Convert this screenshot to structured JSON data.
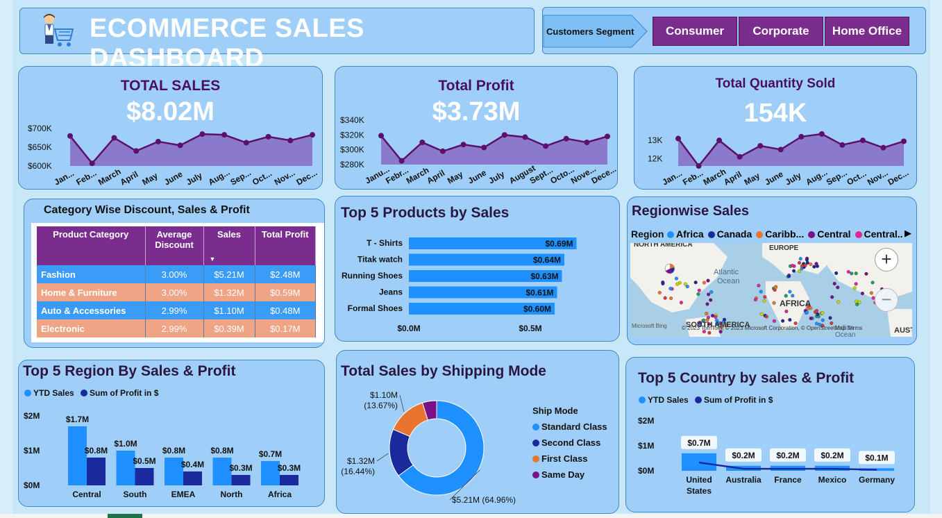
{
  "header": {
    "title": "ECOMMERCE SALES DASHBOARD",
    "segment_label": "Customers Segment",
    "segments": [
      "Consumer",
      "Corporate",
      "Home Office"
    ]
  },
  "colors": {
    "purple": "#7b2d8e",
    "dark_purple": "#4a0f5c",
    "line": "#5c0f6b",
    "area": "#8a74c9",
    "blue": "#1e90ff",
    "navy": "#1a2a9c",
    "orange": "#e8742f",
    "magenta": "#7a0f8a",
    "card": "#9fcff8",
    "row_blue": "#3a9cf7",
    "row_peach": "#efa486"
  },
  "kpis": {
    "sales": {
      "title": "TOTAL SALES",
      "value": "$8.02M"
    },
    "profit": {
      "title": "Total Profit",
      "value": "$3.73M"
    },
    "quantity": {
      "title": "Total Quantity Sold",
      "value": "154K"
    }
  },
  "category_table": {
    "title": "Category Wise Discount, Sales & Profit",
    "headers": [
      "Product Category",
      "Average Discount",
      "Sales",
      "Total Profit"
    ],
    "rows": [
      [
        "Fashion",
        "3.00%",
        "$5.21M",
        "$2.48M"
      ],
      [
        "Home & Furniture",
        "3.00%",
        "$1.32M",
        "$0.59M"
      ],
      [
        "Auto & Accessories",
        "2.99%",
        "$1.10M",
        "$0.48M"
      ],
      [
        "Electronic",
        "2.99%",
        "$0.39M",
        "$0.17M"
      ]
    ]
  },
  "map": {
    "title": "Regionwise Sales",
    "legend_title": "Region",
    "legend": [
      {
        "name": "Africa",
        "color": "#1e90ff"
      },
      {
        "name": "Canada",
        "color": "#1a2a9c"
      },
      {
        "name": "Caribb...",
        "color": "#e8742f"
      },
      {
        "name": "Central",
        "color": "#7a0f8a"
      },
      {
        "name": "Central...",
        "color": "#e0259b"
      }
    ],
    "labels": [
      "NORTH AMERICA",
      "EUROPE",
      "Atlantic",
      "Ocean",
      "AFRICA",
      "SOUTH AMERICA",
      "Indian",
      "Ocean",
      "AUST"
    ],
    "attribution": "Microsoft Bing",
    "copyright": "© 2023 TomTom, © 2023 Microsoft Corporation, © OpenStreetMap  Terms"
  },
  "chart_data": [
    {
      "id": "monthly_sales",
      "type": "area",
      "categories": [
        "Jan...",
        "Feb...",
        "March",
        "April",
        "May",
        "June",
        "July",
        "Aug...",
        "Sep...",
        "Oct...",
        "Nov...",
        "Dec..."
      ],
      "values": [
        680,
        607,
        675,
        640,
        665,
        655,
        685,
        683,
        662,
        678,
        668,
        683
      ],
      "y_ticks": [
        "$700K",
        "$650K",
        "$600K"
      ],
      "y_tick_values": [
        700,
        650,
        600
      ],
      "ylim": [
        600,
        700
      ],
      "unit": "K$"
    },
    {
      "id": "monthly_profit",
      "type": "area",
      "categories": [
        "Janu...",
        "Febr...",
        "March",
        "April",
        "May",
        "June",
        "July",
        "August",
        "Sept...",
        "Octo...",
        "Nove...",
        "Dece..."
      ],
      "values": [
        319,
        285,
        310,
        298,
        307,
        303,
        320,
        317,
        305,
        315,
        310,
        318
      ],
      "y_ticks": [
        "$340K",
        "$320K",
        "$300K",
        "$280K"
      ],
      "y_tick_values": [
        340,
        320,
        300,
        280
      ],
      "ylim": [
        280,
        340
      ],
      "unit": "K$"
    },
    {
      "id": "monthly_quantity",
      "type": "area",
      "categories": [
        "Jan...",
        "Feb...",
        "March",
        "April",
        "May",
        "June",
        "July",
        "Aug...",
        "Sep...",
        "Oct...",
        "Nov...",
        "Dec..."
      ],
      "values": [
        13.1,
        11.6,
        13.0,
        12.1,
        12.7,
        12.5,
        13.2,
        13.35,
        12.75,
        13.0,
        12.6,
        12.95
      ],
      "y_ticks": [
        "13K",
        "12K"
      ],
      "y_tick_values": [
        13,
        12
      ],
      "ylim": [
        11.6,
        13.5
      ],
      "unit": "K"
    },
    {
      "id": "top_products",
      "type": "bar",
      "title": "Top 5 Products by Sales",
      "categories": [
        "T - Shirts",
        "Titak watch",
        "Running Shoes",
        "Jeans",
        "Formal Shoes"
      ],
      "values": [
        0.69,
        0.64,
        0.63,
        0.61,
        0.6
      ],
      "labels": [
        "$0.69M",
        "$0.64M",
        "$0.63M",
        "$0.61M",
        "$0.60M"
      ],
      "x_ticks": [
        "$0.0M",
        "$0.5M"
      ],
      "x_tick_values": [
        0,
        0.5
      ],
      "unit": "M$"
    },
    {
      "id": "top_regions",
      "type": "bar",
      "title": "Top 5 Region By Sales & Profit",
      "categories": [
        "Central",
        "South",
        "EMEA",
        "North",
        "Africa"
      ],
      "series": [
        {
          "name": "YTD Sales",
          "values": [
            1.7,
            1.0,
            0.8,
            0.8,
            0.7
          ],
          "labels": [
            "$1.7M",
            "$1.0M",
            "$0.8M",
            "$0.8M",
            "$0.7M"
          ]
        },
        {
          "name": "Sum of Profit in  $",
          "values": [
            0.8,
            0.5,
            0.4,
            0.3,
            0.3
          ],
          "labels": [
            "$0.8M",
            "$0.5M",
            "$0.4M",
            "$0.3M",
            "$0.3M"
          ]
        }
      ],
      "y_ticks": [
        "$2M",
        "$1M",
        "$0M"
      ],
      "y_tick_values": [
        2,
        1,
        0
      ],
      "ylim": [
        0,
        2
      ],
      "unit": "M$"
    },
    {
      "id": "shipping_mode",
      "type": "pie",
      "title": "Total Sales by Shipping Mode",
      "legend_title": "Ship Mode",
      "slices": [
        {
          "name": "Standard Class",
          "value": 5.21,
          "percent": 64.96,
          "label": "$5.21M (64.96%)",
          "color": "#1e90ff"
        },
        {
          "name": "Second Class",
          "value": 1.32,
          "percent": 16.44,
          "label": "$1.32M (16.44%)",
          "color": "#1a2a9c"
        },
        {
          "name": "First Class",
          "value": 1.1,
          "percent": 13.67,
          "label": "$1.10M (13.67%)",
          "color": "#e8742f"
        },
        {
          "name": "Same Day",
          "value": 0.39,
          "percent": 4.93,
          "label": "",
          "color": "#7a0f8a"
        }
      ]
    },
    {
      "id": "top_countries",
      "type": "bar",
      "title": "Top 5 Country by sales & Profit",
      "categories": [
        "United States",
        "Australia",
        "France",
        "Mexico",
        "Germany"
      ],
      "series": [
        {
          "name": "YTD Sales",
          "values": [
            0.7,
            0.2,
            0.2,
            0.2,
            0.1
          ],
          "labels": [
            "$0.7M",
            "$0.2M",
            "$0.2M",
            "$0.2M",
            "$0.1M"
          ]
        },
        {
          "name": "Sum of Profit in  $",
          "values": [
            0.33,
            0.08,
            0.08,
            0.08,
            0.04
          ]
        }
      ],
      "y_ticks": [
        "$2M",
        "$1M",
        "$0M"
      ],
      "y_tick_values": [
        2,
        1,
        0
      ],
      "ylim": [
        0,
        2
      ],
      "unit": "M$"
    }
  ]
}
